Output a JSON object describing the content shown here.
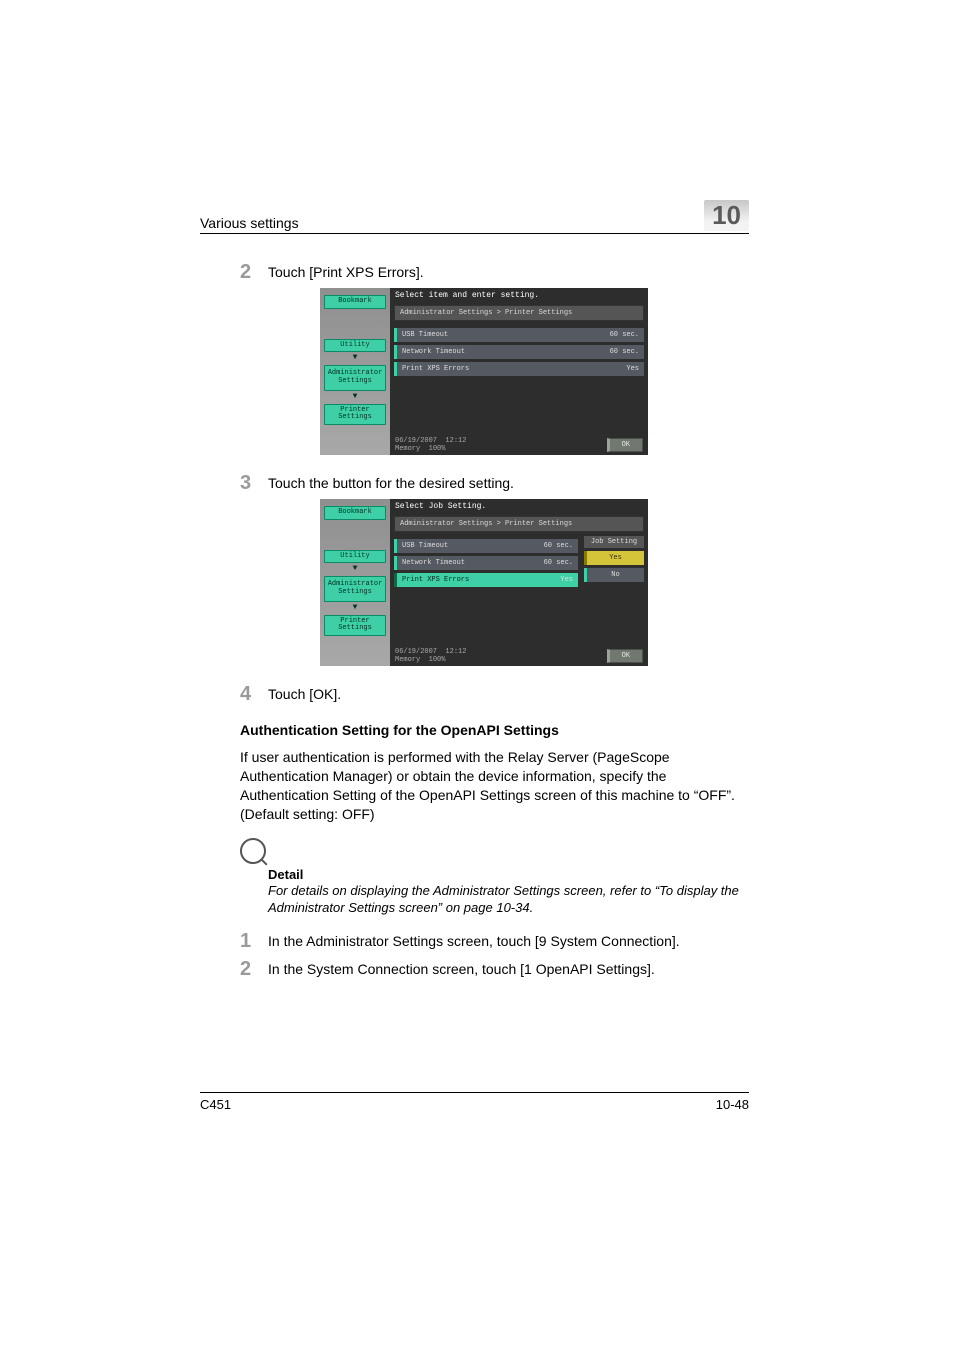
{
  "header": {
    "section": "Various settings",
    "chapter": "10"
  },
  "steps": {
    "s2": {
      "num": "2",
      "text": "Touch [Print XPS Errors]."
    },
    "s3": {
      "num": "3",
      "text": "Touch the button for the desired setting."
    },
    "s4": {
      "num": "4",
      "text": "Touch [OK]."
    },
    "s1b": {
      "num": "1",
      "text": "In the Administrator Settings screen, touch [9 System Connection]."
    },
    "s2b": {
      "num": "2",
      "text": "In the System Connection screen, touch [1 OpenAPI Settings]."
    }
  },
  "shot1": {
    "side": {
      "bookmark": "Bookmark",
      "utility": "Utility",
      "admin": "Administrator\nSettings",
      "printer": "Printer Settings"
    },
    "instr": "Select item and enter setting.",
    "crumb": "Administrator Settings > Printer Settings",
    "rows": [
      {
        "label": "USB Timeout",
        "val": "60",
        "unit": "sec."
      },
      {
        "label": "Network Timeout",
        "val": "60",
        "unit": "sec."
      },
      {
        "label": "Print XPS Errors",
        "val": "Yes",
        "unit": ""
      }
    ],
    "date": "06/19/2007",
    "time": "12:12",
    "mem": "Memory",
    "memv": "100%",
    "ok": "OK"
  },
  "shot2": {
    "instr": "Select Job Setting.",
    "crumb": "Administrator Settings > Printer Settings",
    "jobhdr": "Job Setting",
    "yes": "Yes",
    "no": "No",
    "ok": "OK"
  },
  "section": {
    "title": "Authentication Setting for the OpenAPI Settings",
    "para": "If user authentication is performed with the Relay Server (PageScope Authentication Manager) or obtain the device information, specify the Authentication Setting of the OpenAPI Settings screen of this machine to “OFF”. (Default setting: OFF)"
  },
  "detail": {
    "head": "Detail",
    "body": "For details on displaying the Administrator Settings screen, refer to “To display the Administrator Settings screen” on page 10-34."
  },
  "footer": {
    "model": "C451",
    "page": "10-48"
  }
}
